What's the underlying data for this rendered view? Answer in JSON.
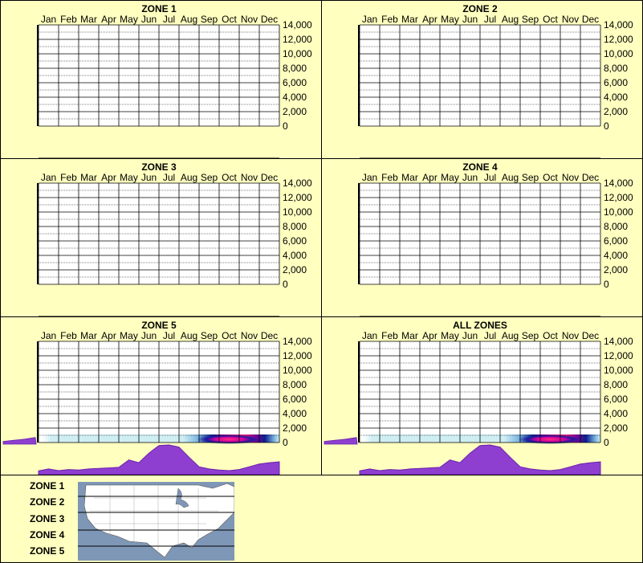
{
  "chart_data": [
    {
      "type": "heatmap",
      "title": "ZONE 1",
      "months": [
        "Jan",
        "Feb",
        "Mar",
        "Apr",
        "May",
        "Jun",
        "Jul",
        "Aug",
        "Sep",
        "Oct",
        "Nov",
        "Dec"
      ],
      "y_ticks": [
        "14,000",
        "12,000",
        "10,000",
        "8,000",
        "6,000",
        "4,000",
        "2,000",
        "0"
      ],
      "ylim": [
        0,
        14000
      ],
      "grid": true,
      "has_data": false
    },
    {
      "type": "heatmap",
      "title": "ZONE 2",
      "months": [
        "Jan",
        "Feb",
        "Mar",
        "Apr",
        "May",
        "Jun",
        "Jul",
        "Aug",
        "Sep",
        "Oct",
        "Nov",
        "Dec"
      ],
      "y_ticks": [
        "14,000",
        "12,000",
        "10,000",
        "8,000",
        "6,000",
        "4,000",
        "2,000",
        "0"
      ],
      "ylim": [
        0,
        14000
      ],
      "grid": true,
      "has_data": false
    },
    {
      "type": "heatmap",
      "title": "ZONE 3",
      "months": [
        "Jan",
        "Feb",
        "Mar",
        "Apr",
        "May",
        "Jun",
        "Jul",
        "Aug",
        "Sep",
        "Oct",
        "Nov",
        "Dec"
      ],
      "y_ticks": [
        "14,000",
        "12,000",
        "10,000",
        "8,000",
        "6,000",
        "4,000",
        "2,000",
        "0"
      ],
      "ylim": [
        0,
        14000
      ],
      "grid": true,
      "has_data": false
    },
    {
      "type": "heatmap",
      "title": "ZONE 4",
      "months": [
        "Jan",
        "Feb",
        "Mar",
        "Apr",
        "May",
        "Jun",
        "Jul",
        "Aug",
        "Sep",
        "Oct",
        "Nov",
        "Dec"
      ],
      "y_ticks": [
        "14,000",
        "12,000",
        "10,000",
        "8,000",
        "6,000",
        "4,000",
        "2,000",
        "0"
      ],
      "ylim": [
        0,
        14000
      ],
      "grid": true,
      "has_data": false
    },
    {
      "type": "heatmap",
      "title": "ZONE 5",
      "months": [
        "Jan",
        "Feb",
        "Mar",
        "Apr",
        "May",
        "Jun",
        "Jul",
        "Aug",
        "Sep",
        "Oct",
        "Nov",
        "Dec"
      ],
      "y_ticks": [
        "14,000",
        "12,000",
        "10,000",
        "8,000",
        "6,000",
        "4,000",
        "2,000",
        "0"
      ],
      "ylim": [
        0,
        14000
      ],
      "grid": true,
      "has_data": true,
      "hotspot": {
        "month_center": 10.0,
        "month_halfwidth": 2.6,
        "elevation": 0
      },
      "monthly_profile": [
        0.05,
        0.12,
        0.06,
        0.1,
        0.08,
        0.12,
        0.14,
        0.16,
        0.18,
        0.45,
        0.35,
        0.7,
        0.98,
        1.0,
        0.92,
        0.55,
        0.2,
        0.12,
        0.08,
        0.06,
        0.1,
        0.2,
        0.3,
        0.35,
        0.38
      ],
      "side_profile": [
        0.2,
        0.3,
        0.4,
        0.5,
        0.6,
        0.75,
        0.9
      ]
    },
    {
      "type": "heatmap",
      "title": "ALL ZONES",
      "months": [
        "Jan",
        "Feb",
        "Mar",
        "Apr",
        "May",
        "Jun",
        "Jul",
        "Aug",
        "Sep",
        "Oct",
        "Nov",
        "Dec"
      ],
      "y_ticks": [
        "14,000",
        "12,000",
        "10,000",
        "8,000",
        "6,000",
        "4,000",
        "2,000",
        "0"
      ],
      "ylim": [
        0,
        14000
      ],
      "grid": true,
      "has_data": true,
      "hotspot": {
        "month_center": 10.0,
        "month_halfwidth": 2.6,
        "elevation": 0
      },
      "monthly_profile": [
        0.05,
        0.12,
        0.06,
        0.1,
        0.08,
        0.12,
        0.14,
        0.16,
        0.18,
        0.45,
        0.35,
        0.7,
        0.98,
        1.0,
        0.92,
        0.55,
        0.2,
        0.12,
        0.08,
        0.06,
        0.1,
        0.2,
        0.3,
        0.35,
        0.38
      ],
      "side_profile": [
        0.2,
        0.3,
        0.4,
        0.5,
        0.6,
        0.75,
        0.9
      ]
    }
  ],
  "legend": {
    "zones": [
      "ZONE 1",
      "ZONE 2",
      "ZONE 3",
      "ZONE 4",
      "ZONE 5"
    ]
  }
}
